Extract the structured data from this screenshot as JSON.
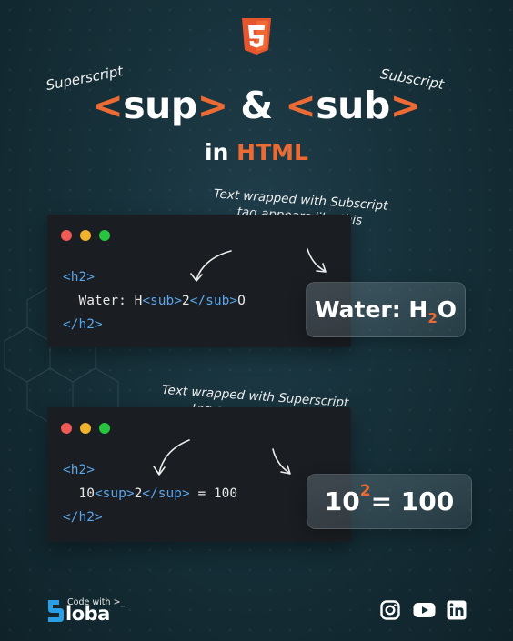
{
  "title": {
    "open_bracket_1": "<",
    "sup_word": "sup",
    "close_bracket_1": ">",
    "ampersand": "&",
    "open_bracket_2": "<",
    "sub_word": "sub",
    "close_bracket_2": ">"
  },
  "subtitle": {
    "prefix": "in",
    "accent": "HTML"
  },
  "labels": {
    "superscript": "Superscript",
    "subscript": "Subscript"
  },
  "notes": {
    "sub_line1": "Text wrapped with Subscript",
    "sub_line2": "tag appears like this",
    "sup_line1": "Text wrapped with Superscript",
    "sup_line2": "tag appears like this"
  },
  "code_sub": {
    "line1": "<h2>",
    "line2_indent": "  ",
    "line2_text1": "Water: H",
    "line2_tag_open": "<sub>",
    "line2_inner": "2",
    "line2_tag_close": "</sub>",
    "line2_text2": "O",
    "line3": "</h2>"
  },
  "code_sup": {
    "line1": "<h2>",
    "line2_indent": "  ",
    "line2_text1": "10",
    "line2_tag_open": "<sup>",
    "line2_inner": "2",
    "line2_tag_close": "</sup>",
    "line2_text2": " = 100",
    "line3": "</h2>"
  },
  "result_sub": {
    "before": "Water: H",
    "low": "2",
    "after": "O"
  },
  "result_sup": {
    "before": "10",
    "high": "2",
    "after": " = 100"
  },
  "brand": {
    "top": "Code with >_",
    "name": "loba"
  },
  "icons": {
    "html5": "html5-logo-icon",
    "instagram": "instagram-icon",
    "youtube": "youtube-icon",
    "linkedin": "linkedin-icon"
  },
  "colors": {
    "accent": "#ec6a33",
    "code_tag": "#5aa6ea",
    "background": "#163039",
    "window": "#1a1d21"
  }
}
